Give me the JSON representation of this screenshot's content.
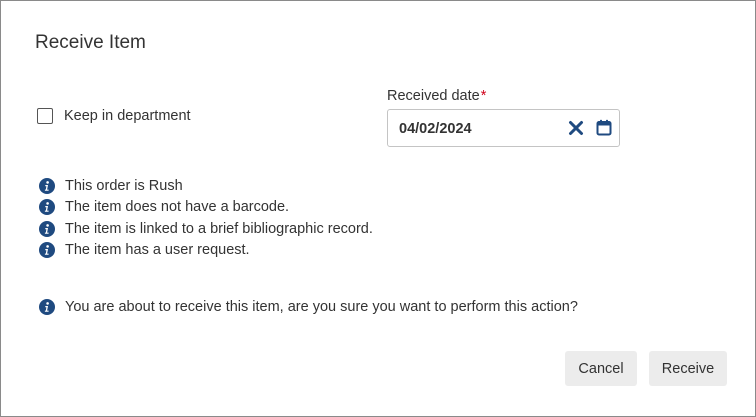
{
  "dialog": {
    "title": "Receive Item"
  },
  "keep_in_department": {
    "label": "Keep in department",
    "checked": false
  },
  "received_date": {
    "label": "Received date",
    "required_marker": "*",
    "value": "04/02/2024"
  },
  "icons": {
    "clear": "close-x-icon",
    "calendar": "calendar-icon",
    "info": "info-circle-icon"
  },
  "colors": {
    "info_icon": "#1f4a80",
    "required": "#d0021b",
    "button_bg": "#ececec"
  },
  "messages": [
    "This order is Rush",
    "The item does not have a barcode.",
    "The item is linked to a brief bibliographic record.",
    "The item has a user request."
  ],
  "confirmation": "You are about to receive this item, are you sure you want to perform this action?",
  "buttons": {
    "cancel": "Cancel",
    "receive": "Receive"
  }
}
